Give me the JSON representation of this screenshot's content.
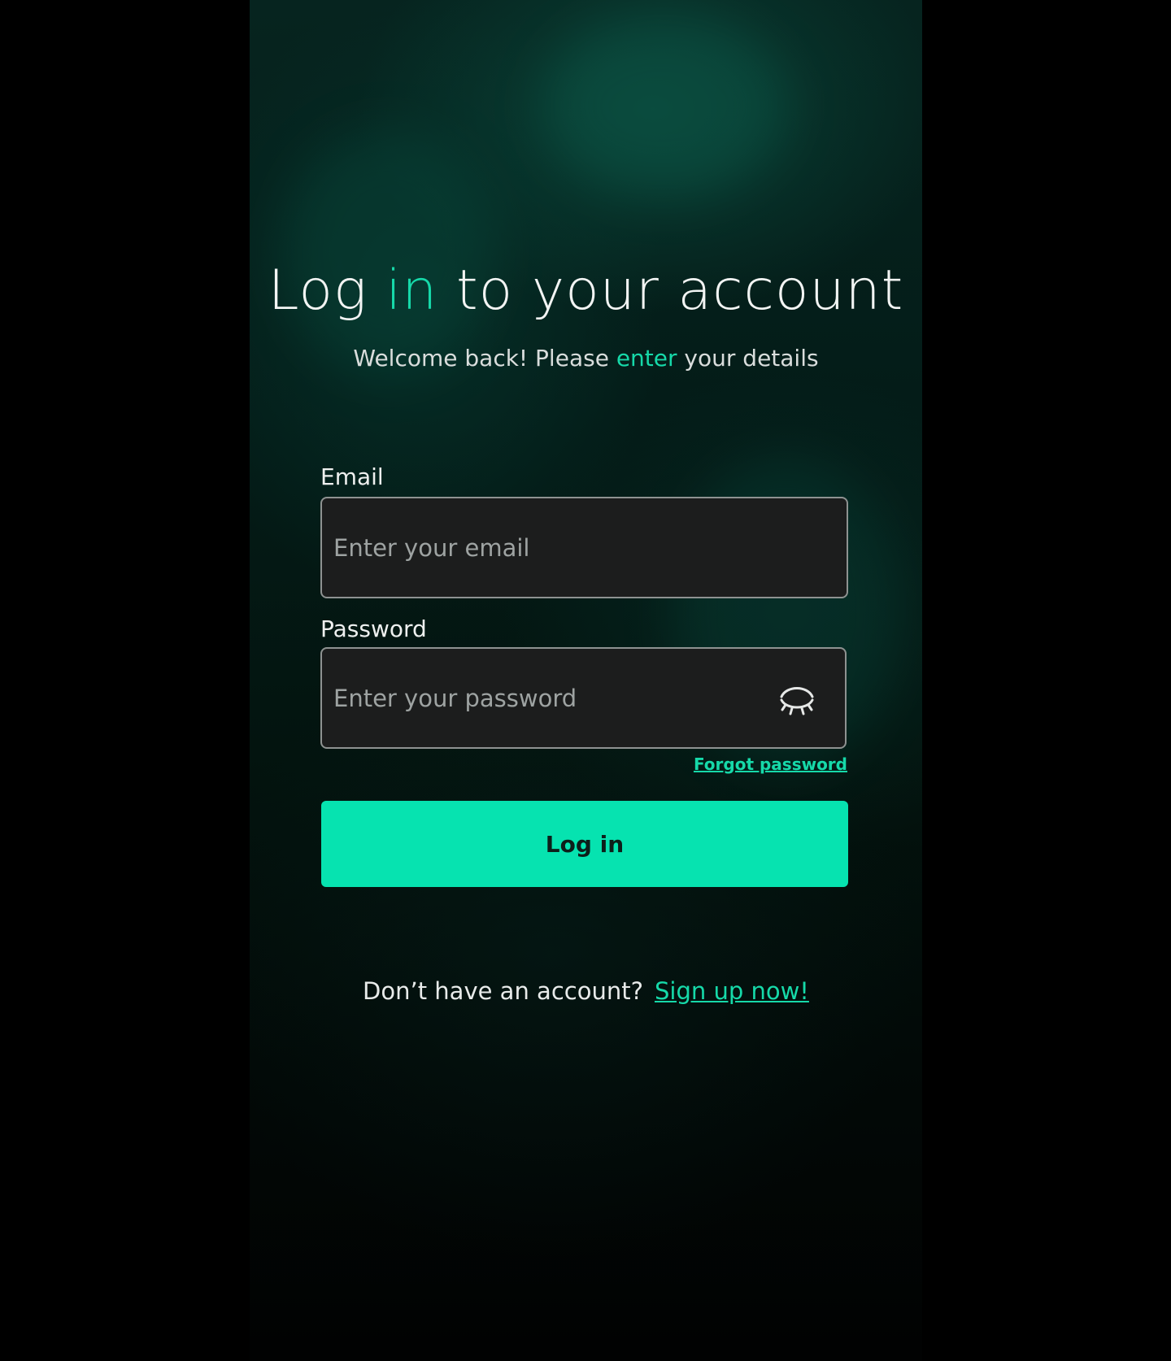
{
  "header": {
    "title_part1": "Log ",
    "title_accent": "in",
    "title_part2": " to your account",
    "subtitle_part1": "Welcome back! Please ",
    "subtitle_accent": "enter",
    "subtitle_part2": " your details"
  },
  "form": {
    "email_label": "Email",
    "email_placeholder": "Enter your email",
    "password_label": "Password",
    "password_placeholder": "Enter your password",
    "password_toggle_icon": "eye-closed-icon",
    "forgot_password": "Forgot password",
    "login_button": "Log in"
  },
  "footer": {
    "prompt": "Don’t have an account?",
    "signup_link": "Sign up now!"
  },
  "colors": {
    "accent": "#16d9a9",
    "button": "#06e3b0",
    "background": "#000000",
    "input_bg": "#1c1d1d"
  }
}
